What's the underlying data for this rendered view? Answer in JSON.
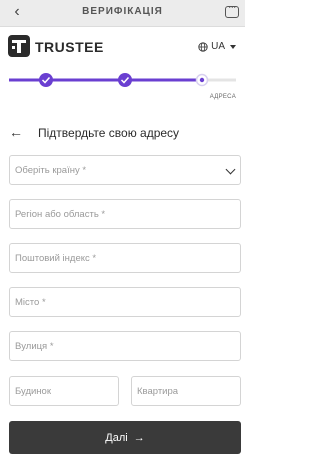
{
  "topbar": {
    "title": "ВЕРИФІКАЦІЯ",
    "back_icon": "back-arrow-icon",
    "chat_icon": "chat-icon"
  },
  "brand": {
    "name": "TRUSTEE"
  },
  "language": {
    "code": "UA"
  },
  "progress": {
    "steps_total": 3,
    "steps_completed": 2,
    "current_step_label": "АДРЕСА",
    "accent": "#6a3fd1"
  },
  "form": {
    "heading": "Підтвердьте свою адресу",
    "country_placeholder": "Оберіть країну *",
    "region_placeholder": "Регіон або область *",
    "postal_placeholder": "Поштовий індекс *",
    "city_placeholder": "Місто *",
    "street_placeholder": "Вулиця *",
    "house_placeholder": "Будинок",
    "apartment_placeholder": "Квартира",
    "next_label": "Далі",
    "next_arrow": "→"
  }
}
